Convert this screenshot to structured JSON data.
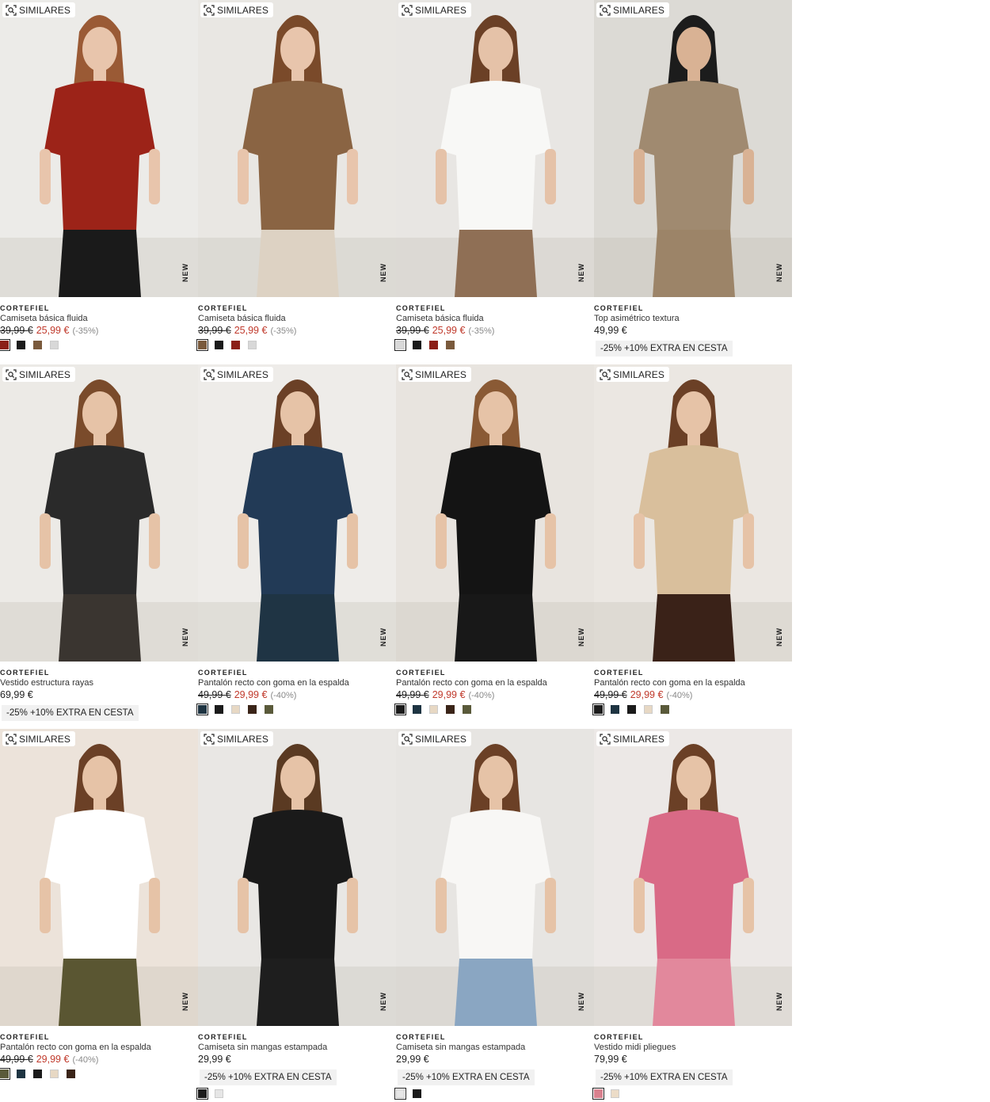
{
  "ui": {
    "similar_label": "SIMILARES",
    "new_label": "NEW"
  },
  "products": [
    {
      "brand": "CORTEFIEL",
      "name": "Camiseta básica fluida",
      "old_price": "39,99 €",
      "sale_price": "25,99 €",
      "discount": "(-35%)",
      "price": "",
      "promo": "",
      "swatches": [
        "#8b1f17",
        "#1b1b1b",
        "#7a5a3c",
        "#d8d8d8"
      ],
      "photo": {
        "bg": "#ecebe8",
        "top": "#9c2318",
        "bottom": "#1a1a1a",
        "skin": "#e8c5ac",
        "hair": "#9a5a35"
      }
    },
    {
      "brand": "CORTEFIEL",
      "name": "Camiseta básica fluida",
      "old_price": "39,99 €",
      "sale_price": "25,99 €",
      "discount": "(-35%)",
      "price": "",
      "promo": "",
      "swatches": [
        "#7a5a3c",
        "#1b1b1b",
        "#8b1f17",
        "#d8d8d8"
      ],
      "photo": {
        "bg": "#e9e7e3",
        "top": "#8a6443",
        "bottom": "#ddd2c3",
        "skin": "#e8c5ac",
        "hair": "#7a4a2a"
      }
    },
    {
      "brand": "CORTEFIEL",
      "name": "Camiseta básica fluida",
      "old_price": "39,99 €",
      "sale_price": "25,99 €",
      "discount": "(-35%)",
      "price": "",
      "promo": "",
      "swatches": [
        "#d8d8d8",
        "#1b1b1b",
        "#8b1f17",
        "#7a5a3c"
      ],
      "photo": {
        "bg": "#e8e6e3",
        "top": "#f8f8f6",
        "bottom": "#8f6f55",
        "skin": "#e5c2a8",
        "hair": "#6b4026"
      }
    },
    {
      "brand": "CORTEFIEL",
      "name": "Top asimétrico textura",
      "old_price": "",
      "sale_price": "",
      "discount": "",
      "price": "49,99 €",
      "promo": "-25% +10% EXTRA EN CESTA",
      "swatches": [],
      "photo": {
        "bg": "#dcdad5",
        "top": "#a08a70",
        "bottom": "#9c8468",
        "skin": "#d9b294",
        "hair": "#1c1c1c"
      }
    },
    {
      "brand": "CORTEFIEL",
      "name": "Vestido estructura rayas",
      "old_price": "",
      "sale_price": "",
      "discount": "",
      "price": "69,99 €",
      "promo": "-25% +10% EXTRA EN CESTA",
      "swatches": [],
      "photo": {
        "bg": "#eceae6",
        "top": "#2a2a2a",
        "bottom": "#3a3530",
        "skin": "#e6c3a7",
        "hair": "#7a4b2b"
      }
    },
    {
      "brand": "CORTEFIEL",
      "name": "Pantalón recto con goma en la espalda",
      "old_price": "49,99 €",
      "sale_price": "29,99 €",
      "discount": "(-40%)",
      "price": "",
      "promo": "",
      "swatches": [
        "#1e3442",
        "#1b1b1b",
        "#e7d8c4",
        "#3a2418",
        "#5a5a3a"
      ],
      "photo": {
        "bg": "#eeece9",
        "top": "#223a56",
        "bottom": "#1f3444",
        "skin": "#e6c3a7",
        "hair": "#6b4026"
      }
    },
    {
      "brand": "CORTEFIEL",
      "name": "Pantalón recto con goma en la espalda",
      "old_price": "49,99 €",
      "sale_price": "29,99 €",
      "discount": "(-40%)",
      "price": "",
      "promo": "",
      "swatches": [
        "#1b1b1b",
        "#1e3442",
        "#e7d8c4",
        "#3a2418",
        "#5a5a3a"
      ],
      "photo": {
        "bg": "#e8e4df",
        "top": "#141414",
        "bottom": "#181818",
        "skin": "#e6c3a7",
        "hair": "#8a5a35"
      }
    },
    {
      "brand": "CORTEFIEL",
      "name": "Pantalón recto con goma en la espalda",
      "old_price": "49,99 €",
      "sale_price": "29,99 €",
      "discount": "(-40%)",
      "price": "",
      "promo": "",
      "swatches": [
        "#1b1b1b",
        "#1e3442",
        "#1b1b1b",
        "#e7d8c4",
        "#5a5a3a"
      ],
      "photo": {
        "bg": "#ebe7e2",
        "top": "#d9bf9c",
        "bottom": "#3a2218",
        "skin": "#e6c3a7",
        "hair": "#6b4026"
      }
    },
    {
      "brand": "CORTEFIEL",
      "name": "Pantalón recto con goma en la espalda",
      "old_price": "49,99 €",
      "sale_price": "29,99 €",
      "discount": "(-40%)",
      "price": "",
      "promo": "",
      "swatches": [
        "#5a5a3a",
        "#1e3442",
        "#1b1b1b",
        "#e7d8c4",
        "#3a2418"
      ],
      "photo": {
        "bg": "#ece3da",
        "top": "#ffffff",
        "bottom": "#5a5632",
        "skin": "#e6c3a7",
        "hair": "#6b4026"
      }
    },
    {
      "brand": "CORTEFIEL",
      "name": "Camiseta sin mangas estampada",
      "old_price": "",
      "sale_price": "",
      "discount": "",
      "price": "29,99 €",
      "promo": "-25% +10% EXTRA EN CESTA",
      "swatches": [
        "#1b1b1b",
        "#e6e6e6"
      ],
      "photo": {
        "bg": "#e9e7e4",
        "top": "#1a1a1a",
        "bottom": "#1e1e1e",
        "skin": "#e6c3a7",
        "hair": "#5a3a22"
      }
    },
    {
      "brand": "CORTEFIEL",
      "name": "Camiseta sin mangas estampada",
      "old_price": "",
      "sale_price": "",
      "discount": "",
      "price": "29,99 €",
      "promo": "-25% +10% EXTRA EN CESTA",
      "swatches": [
        "#e6e6e6",
        "#1b1b1b"
      ],
      "photo": {
        "bg": "#e7e5e2",
        "top": "#f8f7f5",
        "bottom": "#8aa6c2",
        "skin": "#e6c3a7",
        "hair": "#6b4026"
      }
    },
    {
      "brand": "CORTEFIEL",
      "name": "Vestido midi pliegues",
      "old_price": "",
      "sale_price": "",
      "discount": "",
      "price": "79,99 €",
      "promo": "-25% +10% EXTRA EN CESTA",
      "swatches": [
        "#d9818e",
        "#ecdcc8"
      ],
      "photo": {
        "bg": "#ece8e6",
        "top": "#d96a86",
        "bottom": "#e2889c",
        "skin": "#e6c3a7",
        "hair": "#6b4026"
      }
    }
  ]
}
